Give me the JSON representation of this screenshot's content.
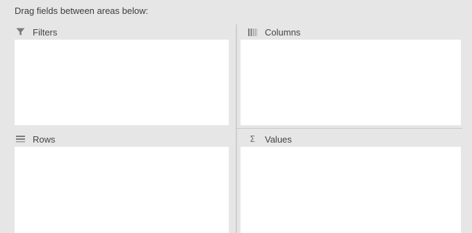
{
  "instruction": "Drag fields between areas below:",
  "areas": {
    "filters": {
      "label": "Filters",
      "icon": "filter-icon"
    },
    "columns": {
      "label": "Columns",
      "icon": "columns-icon"
    },
    "rows": {
      "label": "Rows",
      "icon": "rows-icon"
    },
    "values": {
      "label": "Values",
      "icon": "sigma-icon",
      "glyph": "Σ"
    }
  },
  "colors": {
    "panel_background": "#e6e6e6",
    "drop_area_background": "#ffffff",
    "icon_color": "#7a7a7a"
  }
}
